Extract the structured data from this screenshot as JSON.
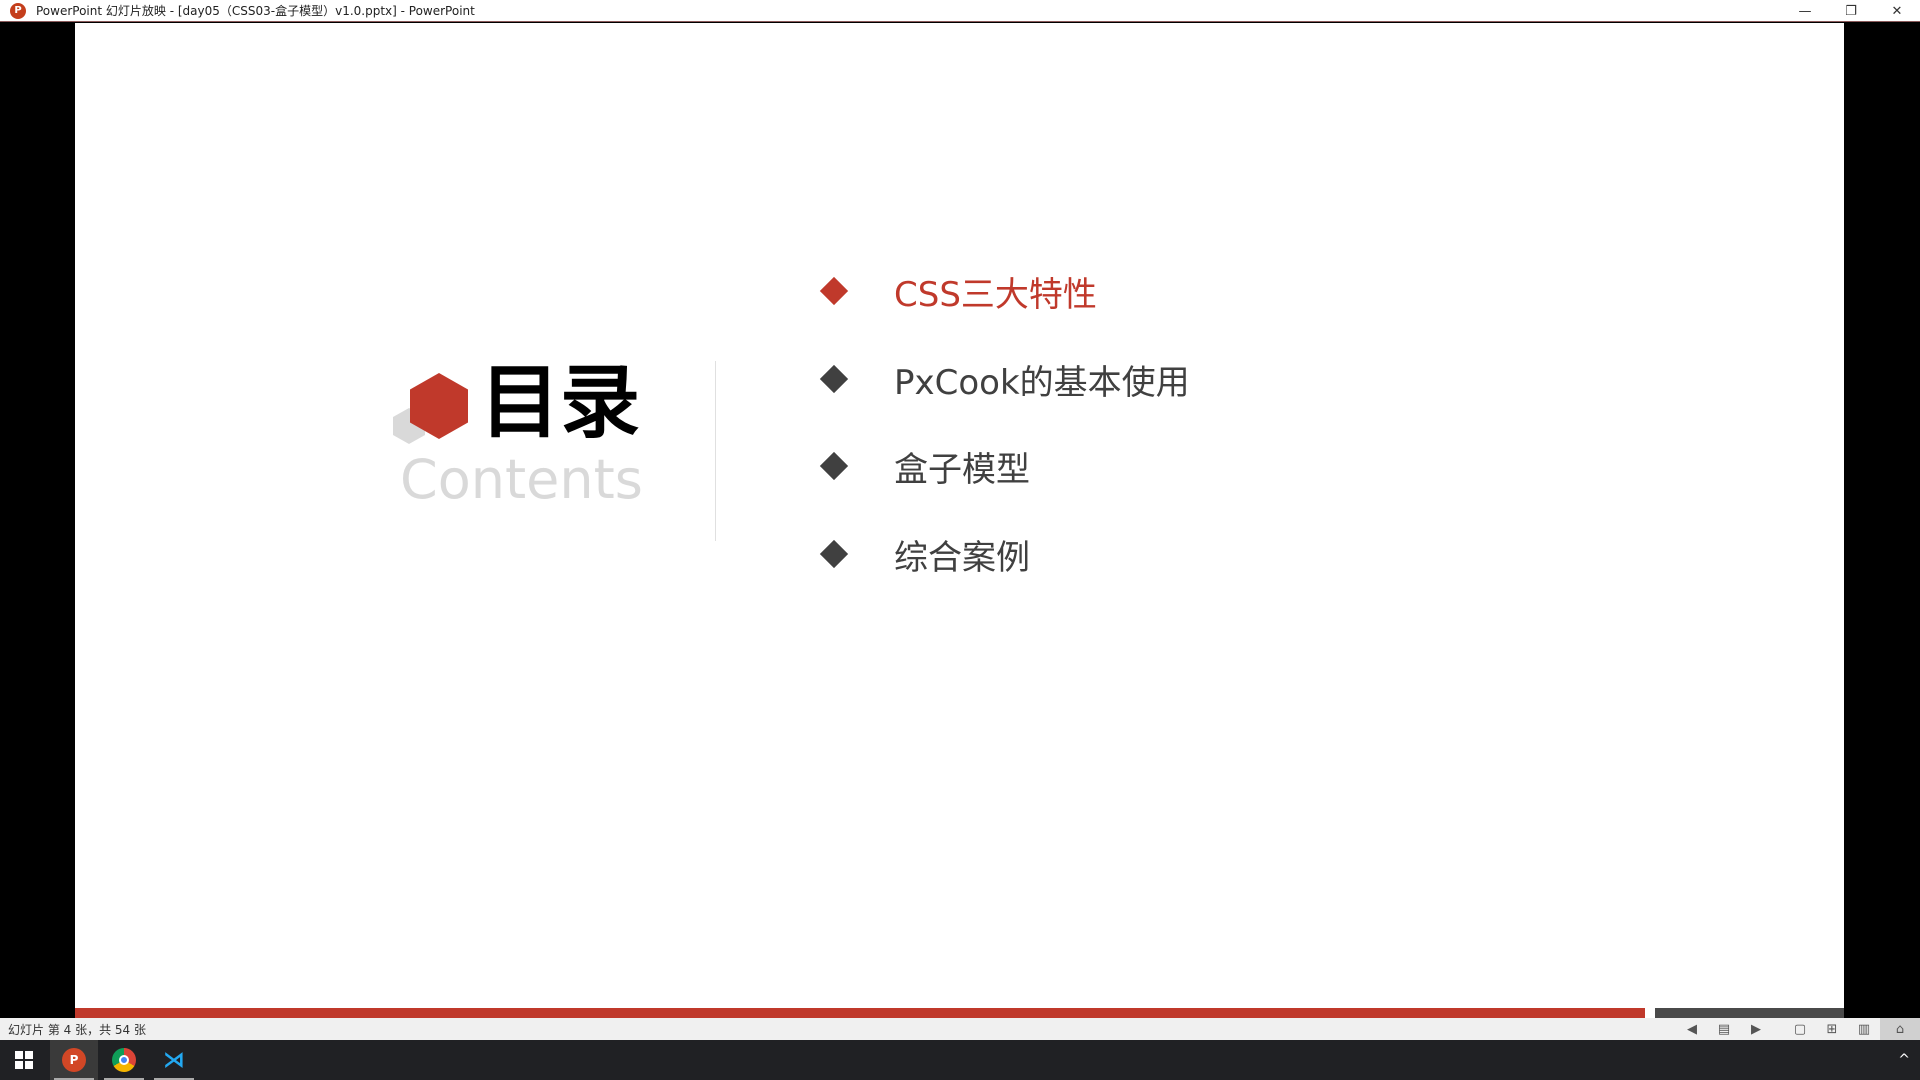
{
  "window": {
    "title": "PowerPoint 幻灯片放映 - [day05（CSS03-盒子模型）v1.0.pptx] - PowerPoint",
    "app_icon_letter": "P",
    "controls": {
      "minimize": "—",
      "restore": "❐",
      "close": "✕"
    }
  },
  "slide": {
    "title": "目录",
    "subtitle": "Contents",
    "items": [
      {
        "label": "CSS三大特性",
        "active": true
      },
      {
        "label": "PxCook的基本使用",
        "active": false
      },
      {
        "label": "盒子模型",
        "active": false
      },
      {
        "label": "综合案例",
        "active": false
      }
    ],
    "colors": {
      "accent": "#c0392b",
      "text": "#404040",
      "subtitle": "#d9d9d9",
      "hex_gray": "#d9d9d9"
    }
  },
  "statusbar": {
    "slide_info": "幻灯片 第 4 张，共 54 张",
    "current_slide": 4,
    "total_slides": 54,
    "icons": [
      {
        "name": "previous-icon",
        "glyph": "◀"
      },
      {
        "name": "notes-icon",
        "glyph": "▤"
      },
      {
        "name": "next-icon",
        "glyph": "▶"
      },
      {
        "name": "normal-view-icon",
        "glyph": "▢"
      },
      {
        "name": "slide-sorter-icon",
        "glyph": "⊞"
      },
      {
        "name": "reading-view-icon",
        "glyph": "▥"
      },
      {
        "name": "slideshow-icon",
        "glyph": "⌂"
      }
    ]
  },
  "taskbar": {
    "apps": [
      "start",
      "powerpoint",
      "chrome",
      "vscode"
    ],
    "ppt_letter": "P",
    "vscode_glyph": "⋊",
    "tray_chevron": "^"
  }
}
